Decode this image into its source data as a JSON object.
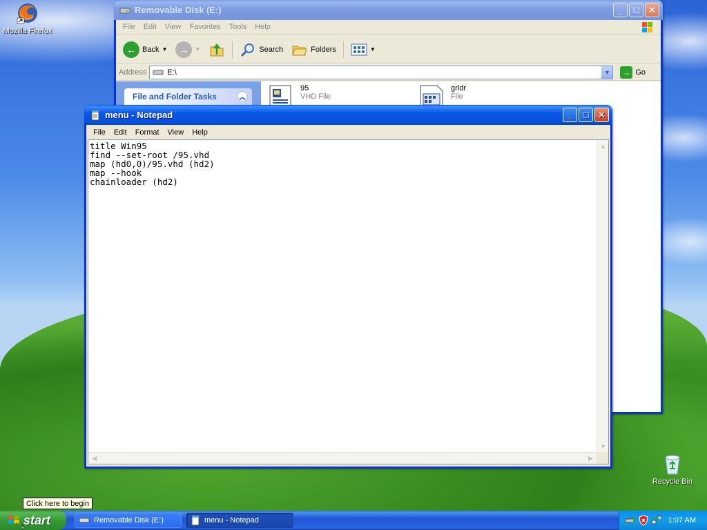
{
  "desktop": {
    "icons": [
      {
        "label": "Mozilla Firefox",
        "icon": "firefox-icon"
      },
      {
        "label": "Recycle Bin",
        "icon": "recycle-bin-icon"
      }
    ]
  },
  "explorer": {
    "title": "Removable Disk (E:)",
    "menu": [
      "File",
      "Edit",
      "View",
      "Favorites",
      "Tools",
      "Help"
    ],
    "toolbar": {
      "back_label": "Back",
      "search_label": "Search",
      "folders_label": "Folders"
    },
    "address": {
      "label": "Address",
      "value": "E:\\",
      "go_label": "Go"
    },
    "task_pane": {
      "title": "File and Folder Tasks"
    },
    "files": [
      {
        "name": "95",
        "type": "VHD File"
      },
      {
        "name": "grldr",
        "type": "File"
      }
    ]
  },
  "notepad": {
    "title": "menu - Notepad",
    "menu": [
      "File",
      "Edit",
      "Format",
      "View",
      "Help"
    ],
    "content": "title Win95\nfind --set-root /95.vhd\nmap (hd0,0)/95.vhd (hd2)\nmap --hook\nchainloader (hd2)"
  },
  "taskbar": {
    "start_label": "start",
    "tooltip": "Click here to begin",
    "tasks": [
      {
        "label": "Removable Disk (E:)",
        "active": false
      },
      {
        "label": "menu - Notepad",
        "active": true
      }
    ],
    "clock": "1:07 AM"
  }
}
